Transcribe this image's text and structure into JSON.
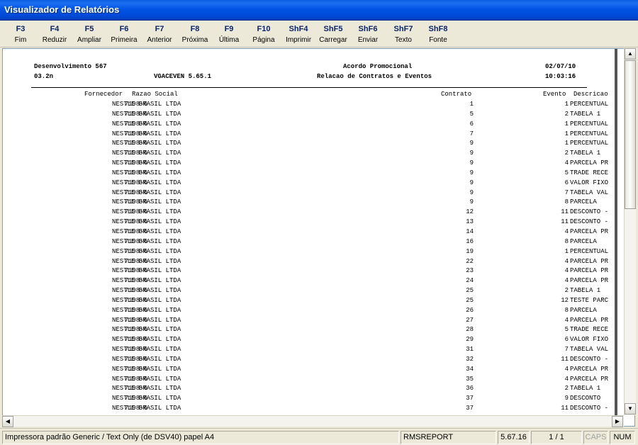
{
  "window": {
    "title": "Visualizador de Relatórios"
  },
  "toolbar": {
    "buttons": [
      {
        "key": "F3",
        "label": "Fim"
      },
      {
        "key": "F4",
        "label": "Reduzir"
      },
      {
        "key": "F5",
        "label": "Ampliar"
      },
      {
        "key": "F6",
        "label": "Primeira"
      },
      {
        "key": "F7",
        "label": "Anterior"
      },
      {
        "key": "F8",
        "label": "Próxima"
      },
      {
        "key": "F9",
        "label": "Última"
      },
      {
        "key": "F10",
        "label": "Página"
      },
      {
        "key": "ShF4",
        "label": "Imprimir"
      },
      {
        "key": "ShF5",
        "label": "Carregar"
      },
      {
        "key": "ShF6",
        "label": "Enviar"
      },
      {
        "key": "ShF7",
        "label": "Texto"
      },
      {
        "key": "ShF8",
        "label": "Fonte"
      }
    ]
  },
  "report": {
    "company": "Desenvolvimento 567",
    "title": "Acordo Promocional",
    "date": "02/07/10",
    "code": "03.2n",
    "program": "VGACEVEN 5.65.1",
    "subtitle": "Relacao de Contratos e Eventos",
    "time": "10:03:16",
    "columns": {
      "fornecedor": "Fornecedor",
      "razao": "Razao Social",
      "contrato": "Contrato",
      "evento": "Evento",
      "descricao": "Descricao"
    },
    "rows": [
      {
        "forn": "7198-6",
        "razao": "NESTLE BRASIL LTDA",
        "contrato": "1",
        "evento": "1",
        "desc": "PERCENTUAL"
      },
      {
        "forn": "7198-6",
        "razao": "NESTLE BRASIL LTDA",
        "contrato": "5",
        "evento": "2",
        "desc": "TABELA 1"
      },
      {
        "forn": "7198-6",
        "razao": "NESTLE BRASIL LTDA",
        "contrato": "6",
        "evento": "1",
        "desc": "PERCENTUAL"
      },
      {
        "forn": "7198-6",
        "razao": "NESTLE BRASIL LTDA",
        "contrato": "7",
        "evento": "1",
        "desc": "PERCENTUAL"
      },
      {
        "forn": "7198-6",
        "razao": "NESTLE BRASIL LTDA",
        "contrato": "9",
        "evento": "1",
        "desc": "PERCENTUAL"
      },
      {
        "forn": "7198-6",
        "razao": "NESTLE BRASIL LTDA",
        "contrato": "9",
        "evento": "2",
        "desc": "TABELA 1"
      },
      {
        "forn": "7198-6",
        "razao": "NESTLE BRASIL LTDA",
        "contrato": "9",
        "evento": "4",
        "desc": "PARCELA PR"
      },
      {
        "forn": "7198-6",
        "razao": "NESTLE BRASIL LTDA",
        "contrato": "9",
        "evento": "5",
        "desc": "TRADE RECE"
      },
      {
        "forn": "7198-6",
        "razao": "NESTLE BRASIL LTDA",
        "contrato": "9",
        "evento": "6",
        "desc": "VALOR FIXO"
      },
      {
        "forn": "7198-6",
        "razao": "NESTLE BRASIL LTDA",
        "contrato": "9",
        "evento": "7",
        "desc": "TABELA VAL"
      },
      {
        "forn": "7198-6",
        "razao": "NESTLE BRASIL LTDA",
        "contrato": "9",
        "evento": "8",
        "desc": "PARCELA"
      },
      {
        "forn": "7198-6",
        "razao": "NESTLE BRASIL LTDA",
        "contrato": "12",
        "evento": "11",
        "desc": "DESCONTO -"
      },
      {
        "forn": "7198-6",
        "razao": "NESTLE BRASIL LTDA",
        "contrato": "13",
        "evento": "11",
        "desc": "DESCONTO -"
      },
      {
        "forn": "7198-6",
        "razao": "NESTLE BRASIL LTDA",
        "contrato": "14",
        "evento": "4",
        "desc": "PARCELA PR"
      },
      {
        "forn": "7198-6",
        "razao": "NESTLE BRASIL LTDA",
        "contrato": "16",
        "evento": "8",
        "desc": "PARCELA"
      },
      {
        "forn": "7198-6",
        "razao": "NESTLE BRASIL LTDA",
        "contrato": "19",
        "evento": "1",
        "desc": "PERCENTUAL"
      },
      {
        "forn": "7198-6",
        "razao": "NESTLE BRASIL LTDA",
        "contrato": "22",
        "evento": "4",
        "desc": "PARCELA PR"
      },
      {
        "forn": "7198-6",
        "razao": "NESTLE BRASIL LTDA",
        "contrato": "23",
        "evento": "4",
        "desc": "PARCELA PR"
      },
      {
        "forn": "7198-6",
        "razao": "NESTLE BRASIL LTDA",
        "contrato": "24",
        "evento": "4",
        "desc": "PARCELA PR"
      },
      {
        "forn": "7198-6",
        "razao": "NESTLE BRASIL LTDA",
        "contrato": "25",
        "evento": "2",
        "desc": "TABELA 1"
      },
      {
        "forn": "7198-6",
        "razao": "NESTLE BRASIL LTDA",
        "contrato": "25",
        "evento": "12",
        "desc": "TESTE PARC"
      },
      {
        "forn": "7198-6",
        "razao": "NESTLE BRASIL LTDA",
        "contrato": "26",
        "evento": "8",
        "desc": "PARCELA"
      },
      {
        "forn": "7198-6",
        "razao": "NESTLE BRASIL LTDA",
        "contrato": "27",
        "evento": "4",
        "desc": "PARCELA PR"
      },
      {
        "forn": "7198-6",
        "razao": "NESTLE BRASIL LTDA",
        "contrato": "28",
        "evento": "5",
        "desc": "TRADE RECE"
      },
      {
        "forn": "7198-6",
        "razao": "NESTLE BRASIL LTDA",
        "contrato": "29",
        "evento": "6",
        "desc": "VALOR FIXO"
      },
      {
        "forn": "7198-6",
        "razao": "NESTLE BRASIL LTDA",
        "contrato": "31",
        "evento": "7",
        "desc": "TABELA VAL"
      },
      {
        "forn": "7198-6",
        "razao": "NESTLE BRASIL LTDA",
        "contrato": "32",
        "evento": "11",
        "desc": "DESCONTO -"
      },
      {
        "forn": "7198-6",
        "razao": "NESTLE BRASIL LTDA",
        "contrato": "34",
        "evento": "4",
        "desc": "PARCELA PR"
      },
      {
        "forn": "7198-6",
        "razao": "NESTLE BRASIL LTDA",
        "contrato": "35",
        "evento": "4",
        "desc": "PARCELA PR"
      },
      {
        "forn": "7198-6",
        "razao": "NESTLE BRASIL LTDA",
        "contrato": "36",
        "evento": "2",
        "desc": "TABELA 1"
      },
      {
        "forn": "7198-6",
        "razao": "NESTLE BRASIL LTDA",
        "contrato": "37",
        "evento": "9",
        "desc": "DESCONTO"
      },
      {
        "forn": "7198-6",
        "razao": "NESTLE BRASIL LTDA",
        "contrato": "37",
        "evento": "11",
        "desc": "DESCONTO -"
      }
    ]
  },
  "statusbar": {
    "printer": "Impressora padrão Generic / Text Only (de DSV40) papel A4",
    "app": "RMSREPORT",
    "version": "5.67.16",
    "page": "1 / 1",
    "caps": "CAPS",
    "num": "NUM"
  }
}
